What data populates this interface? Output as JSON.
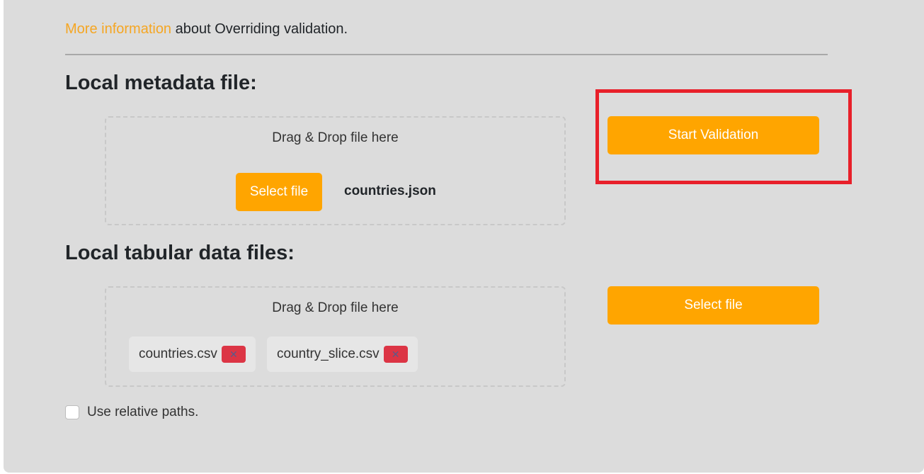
{
  "info": {
    "link_text": "More information",
    "rest_text": " about Overriding validation."
  },
  "metadata_section": {
    "title": "Local metadata file:",
    "dropzone_text": "Drag & Drop file here",
    "select_button": "Select file",
    "selected_file": "countries.json",
    "start_button": "Start Validation"
  },
  "tabular_section": {
    "title": "Local tabular data files:",
    "dropzone_text": "Drag & Drop file here",
    "select_button": "Select file",
    "files": [
      {
        "name": "countries.csv",
        "remove_icon": "✕"
      },
      {
        "name": "country_slice.csv",
        "remove_icon": "✕"
      }
    ]
  },
  "options": {
    "relative_paths_label": "Use relative paths.",
    "relative_paths_checked": false
  },
  "colors": {
    "accent": "#ffa500",
    "link": "#f5a623",
    "remove": "#dc3545",
    "highlight": "#e8202a",
    "panel_bg": "#dcdcdc"
  }
}
